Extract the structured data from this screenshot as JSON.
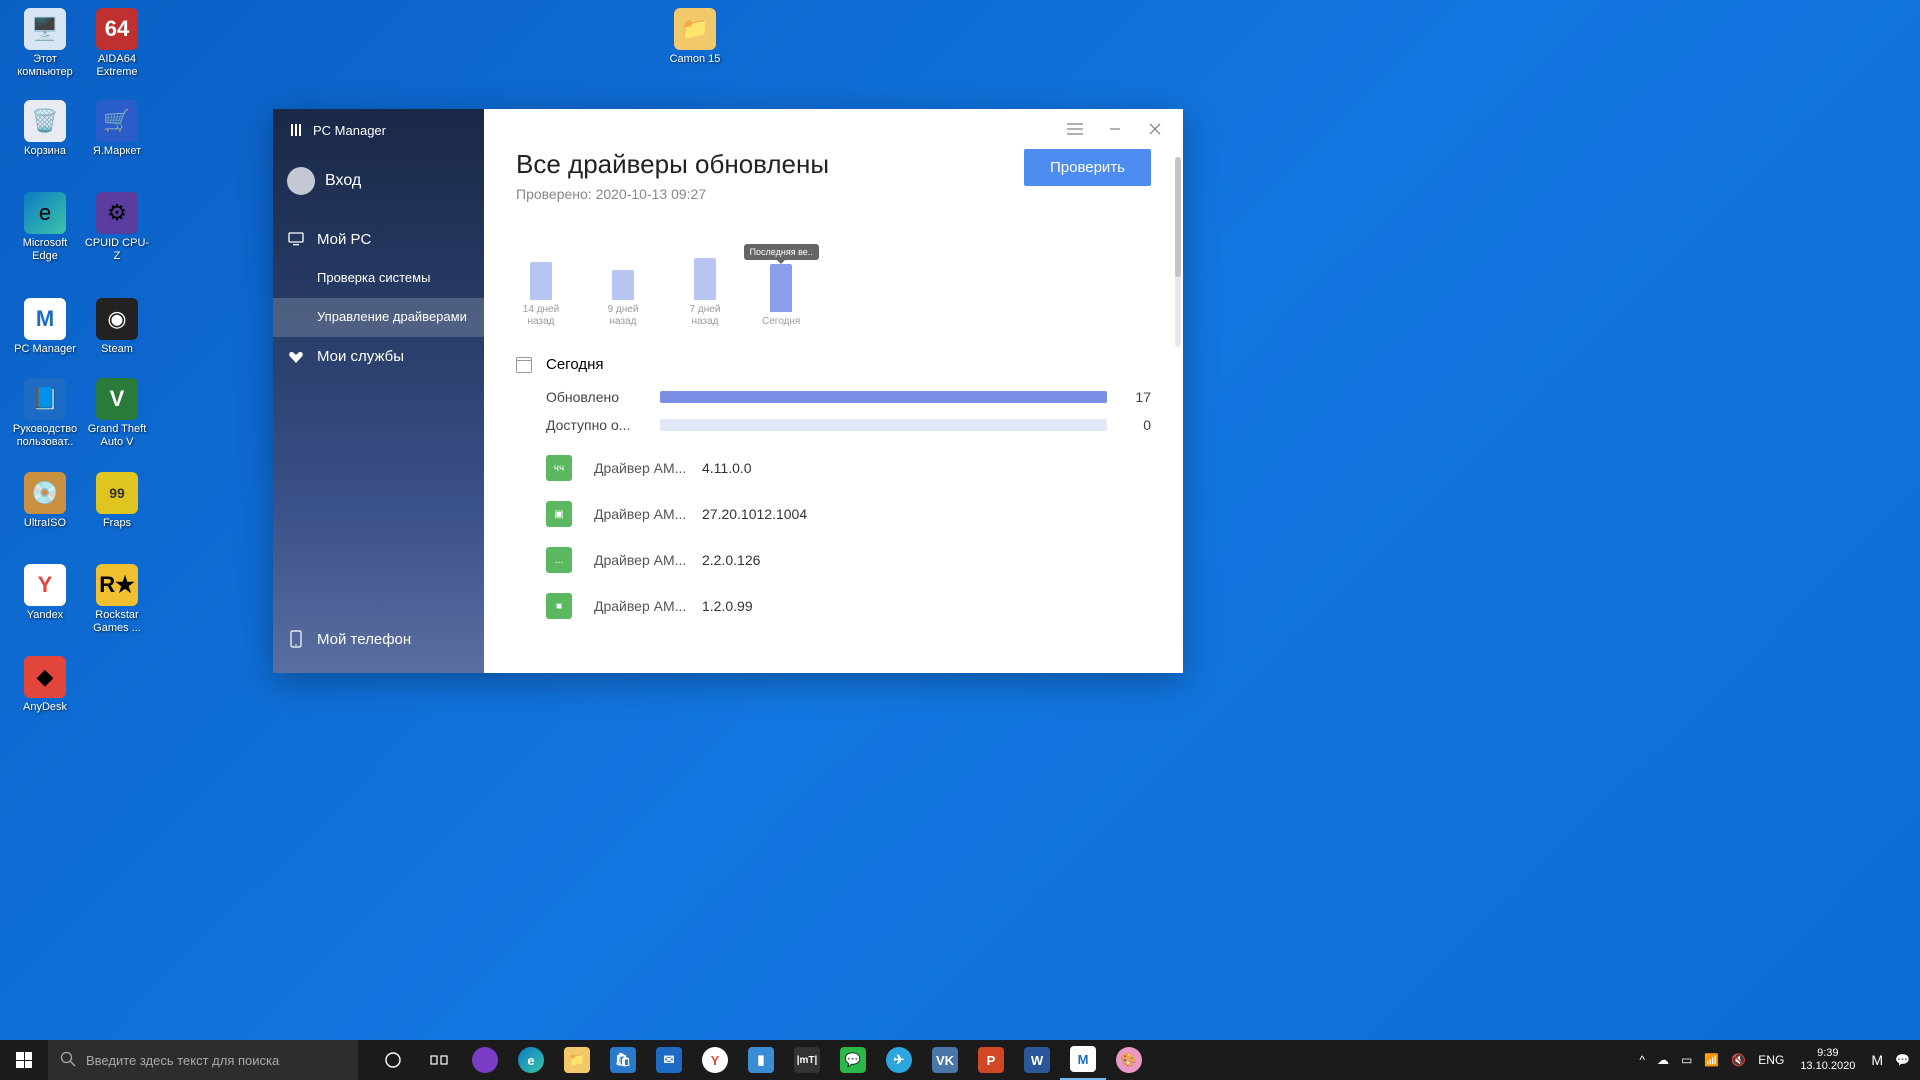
{
  "desktop": {
    "icons": [
      {
        "label": "Этот компьютер",
        "color": "#d8e6f4"
      },
      {
        "label": "AIDA64 Extreme",
        "color": "#c03030"
      },
      {
        "label": "Корзина",
        "color": "#e8ecf2"
      },
      {
        "label": "Я.Маркет",
        "color": "#2a5dc9"
      },
      {
        "label": "Microsoft Edge",
        "color": "#1a8cc8"
      },
      {
        "label": "CPUID CPU-Z",
        "color": "#5a3d9e"
      },
      {
        "label": "PC Manager",
        "color": "#ffffff"
      },
      {
        "label": "Steam",
        "color": "#222"
      },
      {
        "label": "Руководство пользоват..",
        "color": "#1e6bc6"
      },
      {
        "label": "Grand Theft Auto V",
        "color": "#2a7a3a"
      },
      {
        "label": "UltraISO",
        "color": "#c89040"
      },
      {
        "label": "Fraps",
        "color": "#e0c420"
      },
      {
        "label": "Yandex",
        "color": "#fff"
      },
      {
        "label": "Rockstar Games ...",
        "color": "#f0c030"
      },
      {
        "label": "AnyDesk",
        "color": "#e2453c"
      }
    ],
    "folder": {
      "label": "Camon 15"
    }
  },
  "app": {
    "title": "PC Manager",
    "user": "Вход",
    "nav": {
      "my_pc": "Мой PC",
      "system_check": "Проверка системы",
      "driver_mgmt": "Управление драйверами",
      "my_services": "Мои службы",
      "my_phone": "Мой телефон"
    },
    "page": {
      "title": "Все драйверы обновлены",
      "subtitle": "Проверено: 2020-10-13 09:27",
      "check_btn": "Проверить",
      "tooltip": "Последняя ве..",
      "date_header": "Сегодня",
      "stats": {
        "updated_label": "Обновлено",
        "updated_count": "17",
        "available_label": "Доступно о...",
        "available_count": "0"
      }
    }
  },
  "chart_data": {
    "type": "bar",
    "categories": [
      "14 дней назад",
      "9 дней назад",
      "7 дней назад",
      "Сегодня"
    ],
    "values": [
      38,
      30,
      42,
      48
    ],
    "title": "",
    "xlabel": "",
    "ylabel": "",
    "ylim": [
      0,
      50
    ]
  },
  "drivers": [
    {
      "name": "Драйвер AM...",
      "version": "4.11.0.0"
    },
    {
      "name": "Драйвер AM...",
      "version": "27.20.1012.1004"
    },
    {
      "name": "Драйвер AM...",
      "version": "2.2.0.126"
    },
    {
      "name": "Драйвер AM...",
      "version": "1.2.0.99"
    }
  ],
  "taskbar": {
    "search_placeholder": "Введите здесь текст для поиска",
    "lang": "ENG",
    "time": "9:39",
    "date": "13.10.2020"
  }
}
